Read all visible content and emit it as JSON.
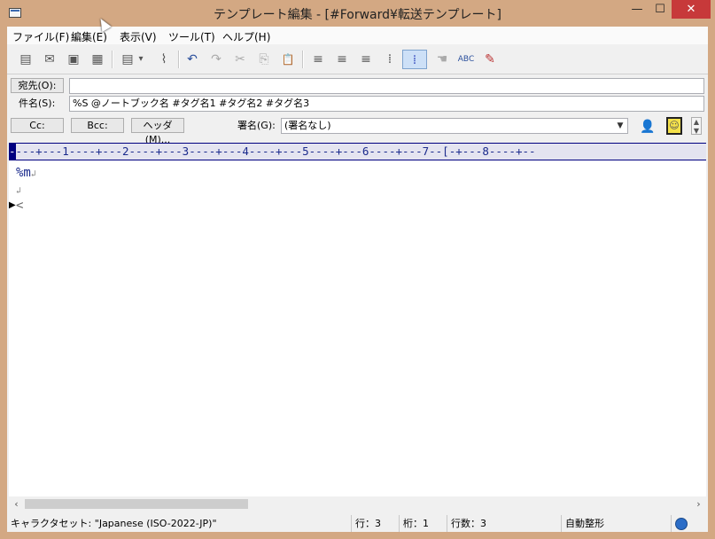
{
  "window": {
    "title": "テンプレート編集 - [#Forward¥転送テンプレート]",
    "controls": {
      "minimize": "—",
      "maximize": "☐",
      "close": "✕"
    }
  },
  "menu": [
    "ファイル(F)",
    "編集(E)",
    "表示(V)",
    "ツール(T)",
    "ヘルプ(H)"
  ],
  "toolbar": {
    "icons": [
      "save-draft-icon",
      "send-icon",
      "print-icon",
      "grid-icon",
      "document-icon",
      "dropdown-icon",
      "attach-icon",
      "undo-icon",
      "redo-icon",
      "cut-icon",
      "copy-icon",
      "paste-icon",
      "align-center-icon",
      "align-left-icon",
      "align-right-icon",
      "dots-icon",
      "dots-active-icon",
      "pointer-icon",
      "spellcheck-icon",
      "edit-icon"
    ],
    "glyphs": [
      "▤",
      "✉",
      "▣",
      "▦",
      "▤",
      "▾",
      "⌇",
      "↶",
      "↷",
      "✂",
      "⎘",
      "📋",
      "≡",
      "≡",
      "≡",
      "⁞",
      "⁞",
      "☚",
      "ABC",
      "✎"
    ]
  },
  "header": {
    "to_button": "宛先(O):",
    "to_value": "",
    "subject_label": "件名(S):",
    "subject_value": "%S @ノートブック名 #タグ名1 #タグ名2 #タグ名3",
    "cc_button": "Cc:",
    "bcc_button": "Bcc:",
    "header_button": "ヘッダ(M)...",
    "signature_label": "署名(G):",
    "signature_value": "(署名なし)"
  },
  "ruler": {
    "cursor": "-",
    "text": "---+---1----+---2----+---3----+---4----+---5----+---6----+---7--[-+---8----+--"
  },
  "editor": {
    "lines": [
      {
        "text": "%m",
        "mark": "↲"
      },
      {
        "text": "",
        "mark": "↲"
      },
      {
        "text": "<",
        "mark": ""
      }
    ],
    "caret_marker": "▶"
  },
  "status": {
    "charset": "キャラクタセット: \"Japanese (ISO-2022-JP)\"",
    "row": "行：3",
    "col": "桁：1",
    "lines": "行数：3",
    "mode": "自動整形"
  },
  "colors": {
    "titlebar": "#d3a883",
    "close": "#c7393a",
    "editor_text": "#1a2a8c",
    "ruler_bg": "#e4e4f0"
  }
}
